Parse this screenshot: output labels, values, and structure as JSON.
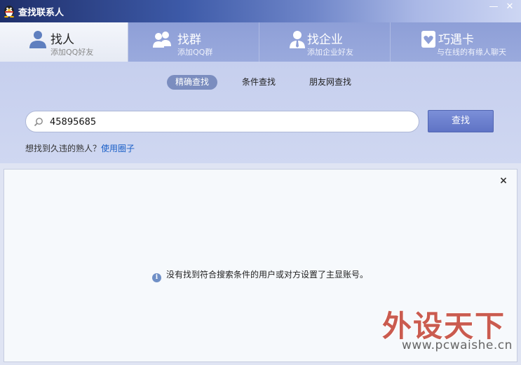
{
  "window": {
    "title": "查找联系人",
    "minimize_label": "—",
    "close_label": "✕"
  },
  "tabs": [
    {
      "title": "找人",
      "subtitle": "添加QQ好友",
      "active": true
    },
    {
      "title": "找群",
      "subtitle": "添加QQ群",
      "active": false
    },
    {
      "title": "找企业",
      "subtitle": "添加企业好友",
      "active": false
    },
    {
      "title": "巧遇卡",
      "subtitle": "与在线的有缘人聊天",
      "active": false
    }
  ],
  "search_modes": [
    {
      "label": "精确查找",
      "active": true
    },
    {
      "label": "条件查找",
      "active": false
    },
    {
      "label": "朋友网查找",
      "active": false
    }
  ],
  "search": {
    "value": "45895685",
    "button_label": "查找"
  },
  "hint": {
    "text": "想找到久违的熟人？",
    "link": "使用圈子"
  },
  "results": {
    "close_label": "×",
    "message": "没有找到符合搜索条件的用户或对方设置了主显账号。"
  },
  "watermark": {
    "brand": "外设天下",
    "url": "www.pcwaishe.cn"
  },
  "colors": {
    "accent": "#5f73c5",
    "link": "#1a5fc7",
    "tab_bar": "#9aaadd"
  }
}
